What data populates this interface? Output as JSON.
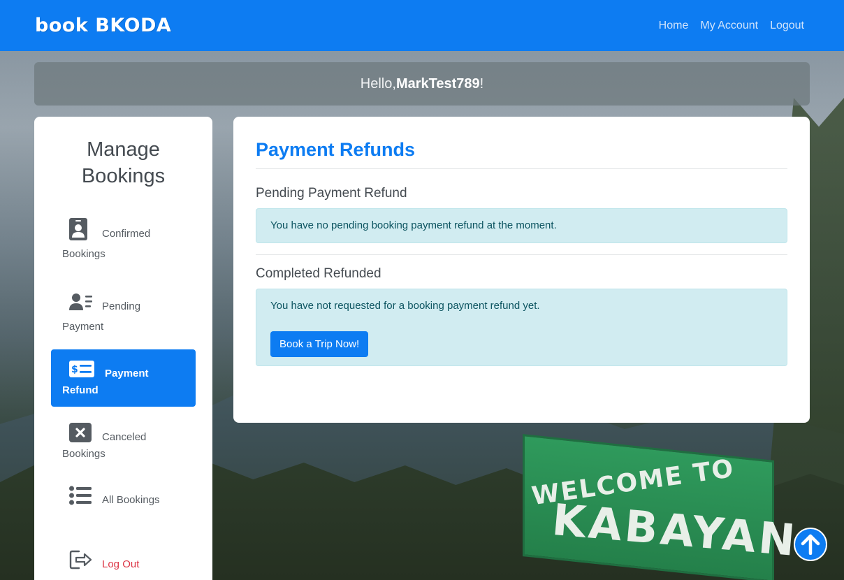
{
  "brand": "book BKODA",
  "nav": {
    "home": "Home",
    "my_account": "My Account",
    "logout": "Logout"
  },
  "greeting": {
    "prefix": "Hello, ",
    "username": "MarkTest789",
    "suffix": "!"
  },
  "sidebar": {
    "title_line1": "Manage",
    "title_line2": "Bookings",
    "items": [
      {
        "label_line1": "Confirmed",
        "label_line2": "Bookings",
        "icon": "id-badge-icon"
      },
      {
        "label_line1": "Pending",
        "label_line2": "Payment",
        "icon": "user-list-icon"
      },
      {
        "label_line1": "Payment",
        "label_line2": "Refund",
        "icon": "money-bill-icon"
      },
      {
        "label_line1": "Canceled",
        "label_line2": "Bookings",
        "icon": "close-box-icon"
      },
      {
        "label_line1": "All Bookings",
        "icon": "list-icon"
      },
      {
        "label_line1": "Log Out",
        "icon": "sign-out-icon"
      }
    ]
  },
  "main": {
    "title": "Payment Refunds",
    "pending": {
      "heading": "Pending Payment Refund",
      "message": "You have no pending booking payment refund at the moment."
    },
    "completed": {
      "heading": "Completed Refunded",
      "message": "You have not requested for a booking payment refund yet.",
      "button": "Book a Trip Now!"
    }
  },
  "background_sign": {
    "line1": "WELCOME TO",
    "line2": "KABAYAN"
  },
  "colors": {
    "primary": "#0d7cf2",
    "alert_bg": "#d1ecf1",
    "alert_text": "#0c5460",
    "danger": "#dc3545"
  }
}
